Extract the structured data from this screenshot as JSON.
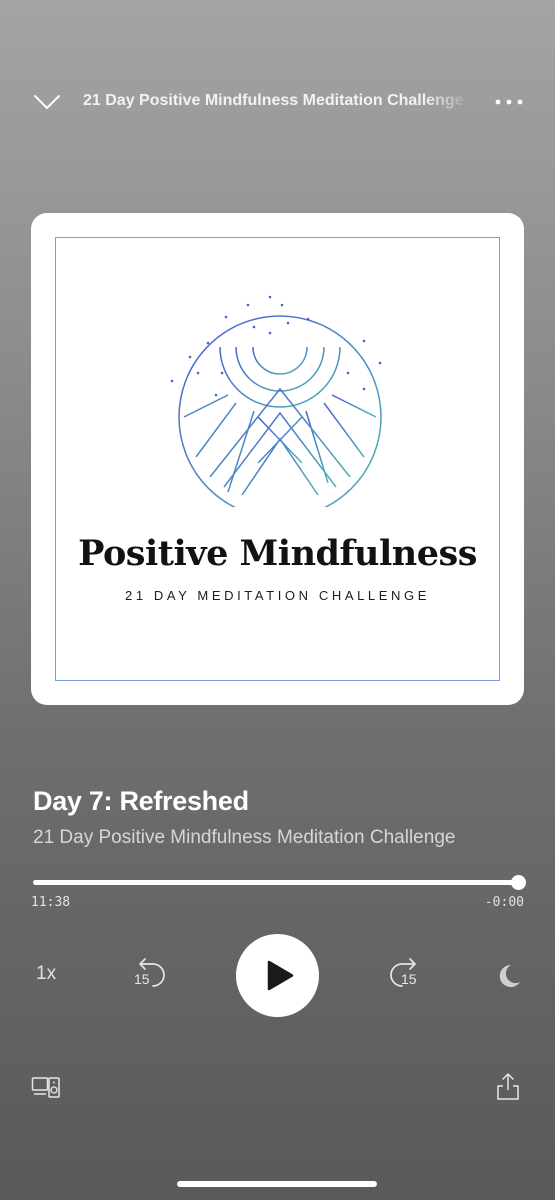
{
  "header": {
    "title": "21 Day Positive Mindfulness Meditation Challenge",
    "collapse_icon": "chevron-down-icon",
    "more_icon": "more-horizontal-icon"
  },
  "artwork": {
    "title": "Positive Mindfulness",
    "subtitle": "21 DAY MEDITATION CHALLENGE",
    "accent_colors": [
      "#4a5fd6",
      "#4fb3b5"
    ]
  },
  "track": {
    "title": "Day 7: Refreshed",
    "show": "21 Day Positive Mindfulness Meditation Challenge"
  },
  "progress": {
    "fraction": 1.0,
    "elapsed": "11:38",
    "remaining": "-0:00"
  },
  "controls": {
    "speed": "1x",
    "skip_back_seconds": "15",
    "skip_forward_seconds": "15",
    "play_icon": "play-icon",
    "sleep_icon": "moon-icon"
  },
  "footer": {
    "devices_icon": "connect-devices-icon",
    "share_icon": "share-icon"
  }
}
